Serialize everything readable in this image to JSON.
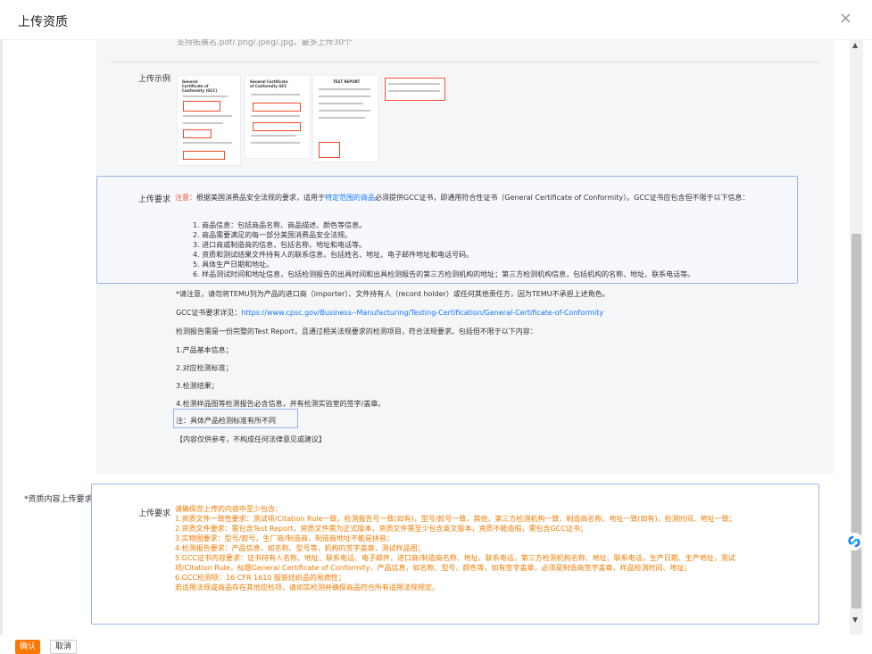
{
  "dialog": {
    "title": "上传资质",
    "close_icon": "×"
  },
  "upload": {
    "format_hint": "支持拓展名.pdf/.png/.jpeg/.jpg，最多上传30个",
    "example_label": "上传示例",
    "thumbnails": [
      {
        "title": "General Certificate of Conformity (GCC)"
      },
      {
        "title": "General Certificate of Conformity GCC"
      },
      {
        "title": "TEST REPORT"
      },
      {
        "title": ""
      }
    ]
  },
  "requirements": {
    "label": "上传要求",
    "note_prefix": "注意：",
    "intro_part1": "根据美国消费品安全法规的要求，适用于",
    "intro_link": "特定范围的商品",
    "intro_part2": "必须提供GCC证书，即通用符合性证书（General Certificate of Conformity）。GCC证书应包含但不限于以下信息：",
    "items": [
      "1. 商品信息：包括商品名称、商品描述、颜色等信息。",
      "2. 商品需要满足的每一部分美国消费品安全法规。",
      "3. 进口商或制造商的信息，包括名称、地址和电话等。",
      "4. 资质和测试结果文件持有人的联系信息，包括姓名、地址、电子邮件地址和电话号码。",
      "5. 具体生产日期和地址。",
      "6. 样品测试时间和地址信息，包括检测报告的出具时间和出具检测报告的第三方检测机构的地址；第三方检测机构信息，包括机构的名称、地址、联系电话等。"
    ],
    "notice": "*请注意，请勿将TEMU列为产品的进口商（importer）、文件持有人（record holder）或任何其他责任方，因为TEMU不承担上述角色。",
    "gcc_prefix": "GCC证书要求详见：",
    "gcc_link": "https://www.cpsc.gov/Business--Manufacturing/Testing-Certification/General-Certificate-of-Conformity",
    "report_intro": "检测报告需是一份完整的Test Report，且通过相关法规要求的检测项目，符合法规要求。包括但不限于以下内容：",
    "report_items": [
      "1.产品基本信息；",
      "2.对应检测标准；",
      "3.检测结果；",
      "4.检测样品图等检测报告必含信息，并有检测实验室的签字/盖章。"
    ],
    "report_note": "注：具体产品检测标准有所不同",
    "disclaimer": "【内容仅供参考，不构成任何法律意见或建议】"
  },
  "content_requirements": {
    "field_label": "*资质内容上传要求",
    "label": "上传要求",
    "lines": [
      "请确保您上传的内容中至少包含：",
      "1.资质文件一致性要求：测试项/Citation Rule一致，检测报告号一致(如有)，型号/款号一致，其他，第三方检测机构一致，制造商名称、地址一致(如有)，检测时间、地址一致；",
      "2.资质文件要求：需包含Test Report，资质文件需为正式版本，资质文件需至少包含英文版本，资质不能造假，需包含GCC证书；",
      "3.实物图要求：型号/款号，生厂商/制造商，制造商地址不能是拼音；",
      "4.检测报告要求：产品信息，如名称、型号等，机构的签字盖章，测试样品图；",
      "5.GCC证书内容要求：证书持有人名称、地址、联系电话、电子邮件，进口商/制造商名称、地址、联系电话，第三方检测机构名称、地址、联系电话，生产日期、生产地址，测试",
      "项/Citation Rule，标题General Certificate of Conformity，产品信息，如名称、型号、颜色等，如有签字盖章，必须是制造商签字盖章，样品检测时间、地址；",
      "6.GCC检测项：16 CFR 1610 服装纺织品的易燃性；",
      "若适用法规或商品存在其他应检项，请如实检测并确保商品符合所有适用法规规定。"
    ]
  },
  "footer": {
    "confirm": "确认",
    "cancel": "取消"
  },
  "colors": {
    "primary": "#fb7701",
    "link": "#1677ff",
    "note_red": "#f24a28",
    "box_border": "#9ab5e8"
  }
}
